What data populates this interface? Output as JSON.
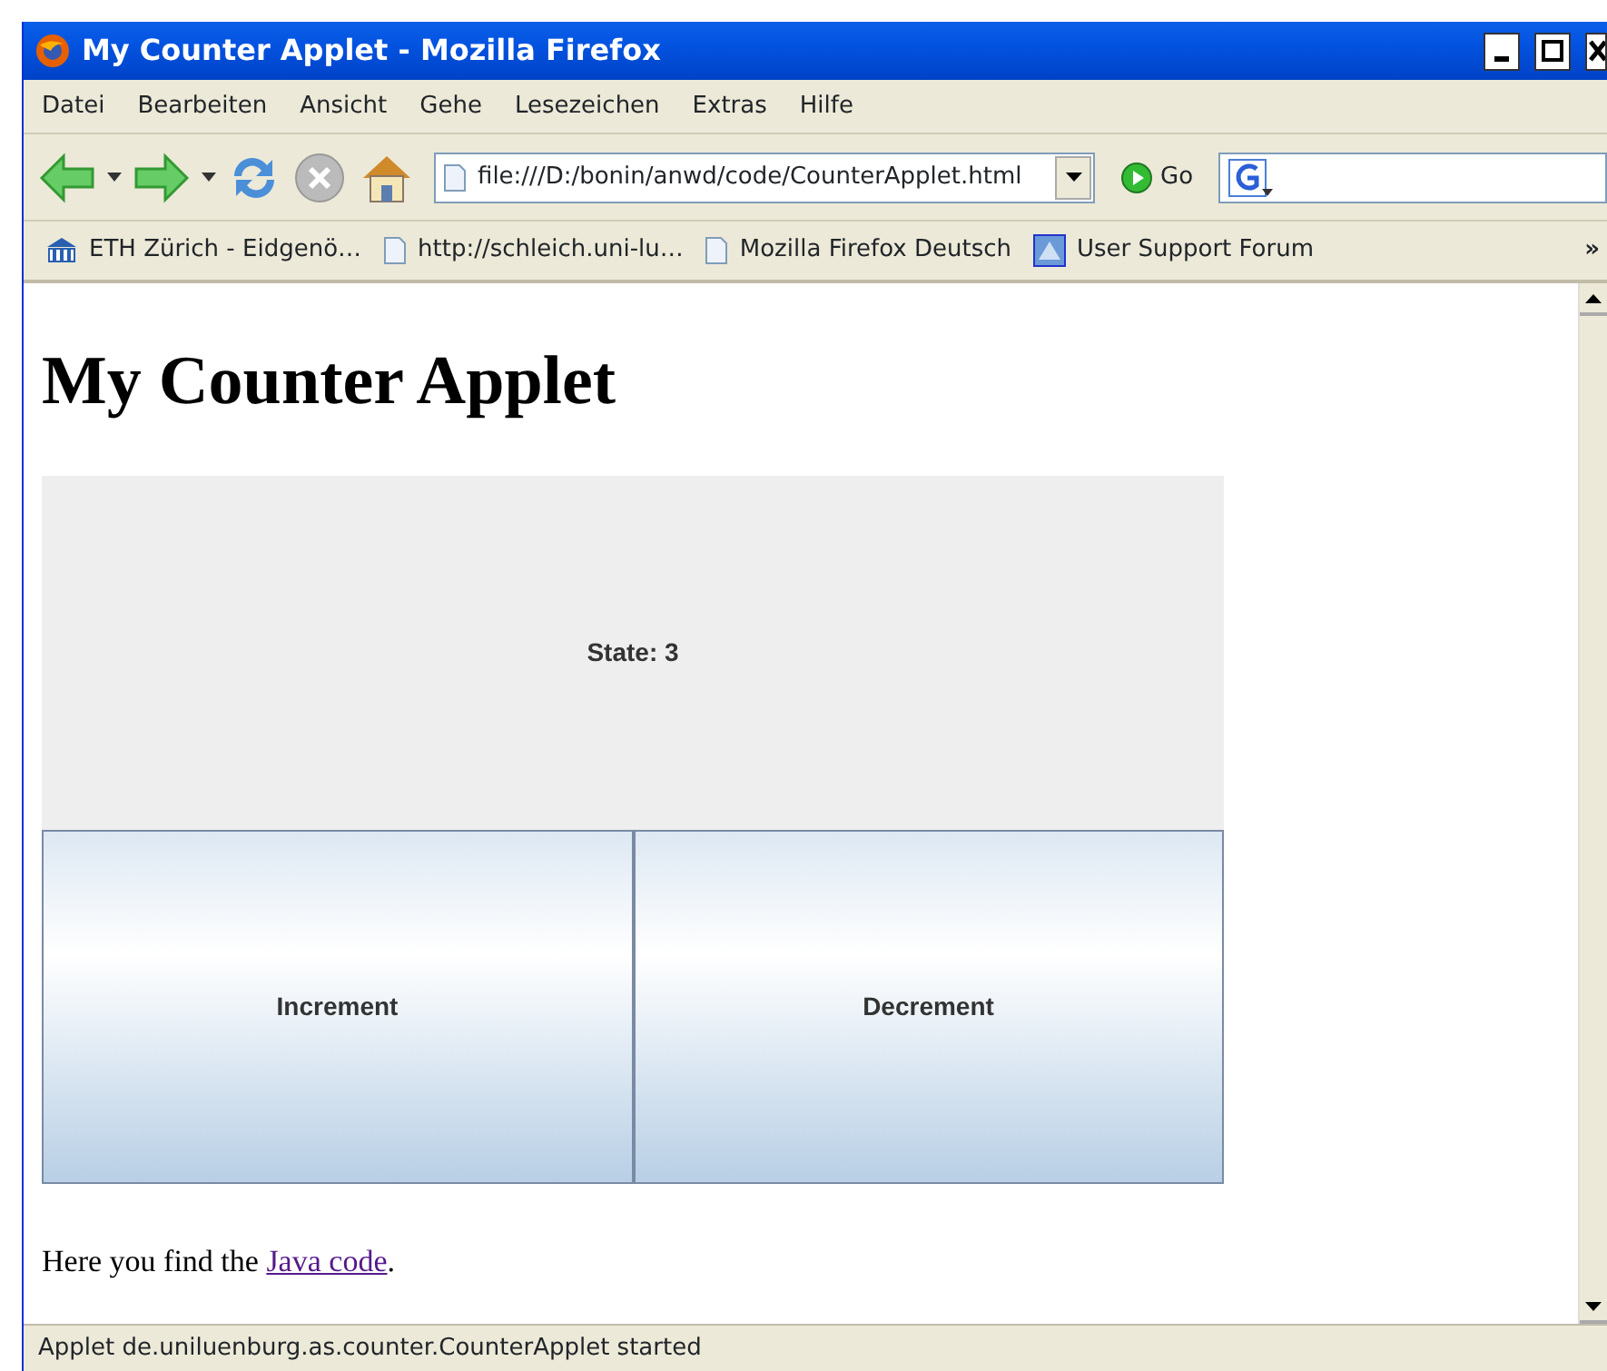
{
  "window": {
    "title": "My Counter Applet - Mozilla Firefox"
  },
  "menu": [
    "Datei",
    "Bearbeiten",
    "Ansicht",
    "Gehe",
    "Lesezeichen",
    "Extras",
    "Hilfe"
  ],
  "toolbar": {
    "address": "file:///D:/bonin/anwd/code/CounterApplet.html",
    "go": "Go"
  },
  "bookmarks": [
    {
      "label": "ETH Zürich - Eidgenö…",
      "kind": "eth"
    },
    {
      "label": "http://schleich.uni-lu…",
      "kind": "page"
    },
    {
      "label": "Mozilla Firefox Deutsch",
      "kind": "page"
    },
    {
      "label": "User Support Forum",
      "kind": "fx"
    }
  ],
  "bookmarks_more": "»",
  "page": {
    "heading": "My Counter Applet",
    "applet": {
      "state": "State: 3",
      "buttons": [
        "Increment",
        "Decrement"
      ]
    },
    "text": "Here you find the ",
    "link": "Java code",
    "text_end": "."
  },
  "status_bar": "Applet de.uniluenburg.as.counter.CounterApplet started"
}
